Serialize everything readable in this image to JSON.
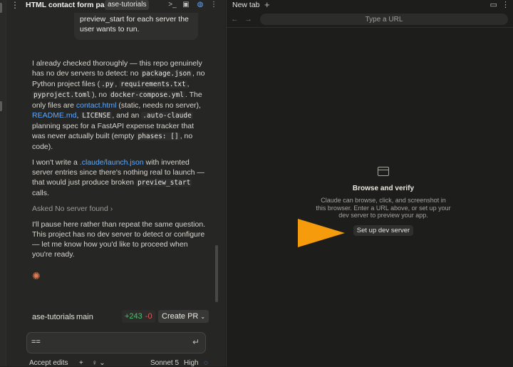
{
  "chat": {
    "title": "HTML contact form page",
    "repo_chip": "ase-tutorials",
    "user_message": "preview_start for each server the user wants to run.",
    "response": {
      "p1": {
        "a": "I already checked thoroughly — this repo genuinely has no dev servers to detect: no ",
        "c1": "package.json",
        "b": ", no Python project files (",
        "c2": ".py",
        "c": ", ",
        "c3": "requirements.txt",
        "d": ", ",
        "c4": "pyproject.toml",
        "e": "), no ",
        "c5": "docker-compose.yml",
        "f": ". The only files are ",
        "l1": "contact.html",
        "g": " (static, needs no server), ",
        "l2": "README.md",
        "h": ", ",
        "c6": "LICENSE",
        "i": ", and an ",
        "c7": ".auto-claude",
        "j": " planning spec for a FastAPI expense tracker that was never actually built (empty ",
        "c8": "phases: []",
        "k": ", no code)."
      },
      "p2": {
        "a": "I won't write a ",
        "l1": ".claude/launch.json",
        "b": " with invented server entries since there's nothing real to launch — that would just produce broken ",
        "c1": "preview_start",
        "c": " calls."
      },
      "asked": "Asked No server found",
      "p3": "I'll pause here rather than repeat the same question. This project has no dev server to detect or configure — let me know how you'd like to proceed when you're ready."
    },
    "repo_row": {
      "repo": "ase-tutorials",
      "branch": "main",
      "additions": "+243",
      "deletions": "-0",
      "create_pr": "Create PR"
    },
    "input": {
      "value": "=="
    },
    "footer": {
      "accept_edits": "Accept edits",
      "model": "Sonnet 5",
      "effort": "High"
    }
  },
  "browser": {
    "tab_label": "New tab",
    "url_placeholder": "Type a URL",
    "empty_title": "Browse and verify",
    "empty_desc": "Claude can browse, click, and screenshot in this browser. Enter a URL above, or set up your dev server to preview your app.",
    "setup_button": "Set up dev server"
  },
  "colors": {
    "accent_link": "#5ea9ff",
    "add_green": "#4fc06f",
    "del_red": "#e05c5c",
    "annotation_arrow": "#f59b0c",
    "spark": "#e17a4f"
  }
}
